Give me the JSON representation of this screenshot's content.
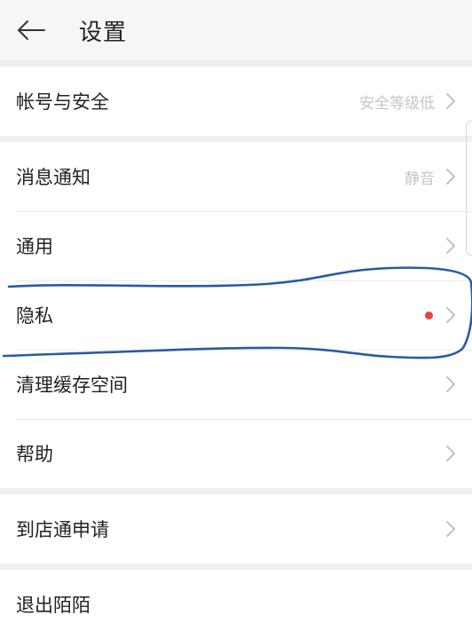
{
  "header": {
    "title": "设置",
    "back_icon": "arrow-left-icon"
  },
  "groups": [
    {
      "items": [
        {
          "label": "帐号与安全",
          "value": "安全等级低",
          "chevron_icon": "chevron-right-icon"
        }
      ]
    },
    {
      "items": [
        {
          "label": "消息通知",
          "value": "静音",
          "chevron_icon": "chevron-right-icon"
        },
        {
          "label": "通用",
          "value": "",
          "chevron_icon": "chevron-right-icon"
        },
        {
          "label": "隐私",
          "value": "",
          "badge": "red-dot",
          "chevron_icon": "chevron-right-icon"
        },
        {
          "label": "清理缓存空间",
          "value": "",
          "chevron_icon": "chevron-right-icon"
        },
        {
          "label": "帮助",
          "value": "",
          "chevron_icon": "chevron-right-icon"
        }
      ]
    },
    {
      "items": [
        {
          "label": "到店通申请",
          "value": "",
          "chevron_icon": "chevron-right-icon"
        }
      ]
    },
    {
      "items": [
        {
          "label": "退出陌陌",
          "value": ""
        }
      ]
    }
  ],
  "colors": {
    "background": "#efefef",
    "header_bg": "#f6f6f6",
    "row_bg": "#ffffff",
    "text": "#222222",
    "value_text": "#c6c6c6",
    "badge_dot": "#e64545",
    "annotation_ink": "#2c5aa0"
  }
}
